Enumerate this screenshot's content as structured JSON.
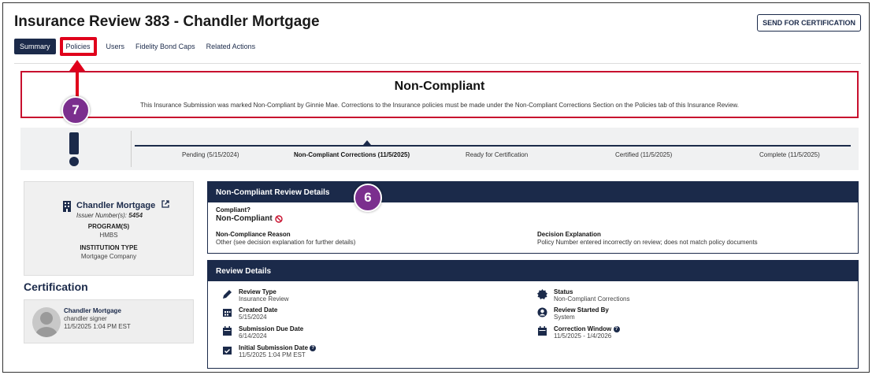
{
  "header": {
    "title": "Insurance Review 383 - Chandler Mortgage",
    "send_button": "SEND FOR CERTIFICATION"
  },
  "tabs": [
    {
      "label": "Summary",
      "active": true
    },
    {
      "label": "Policies",
      "highlighted": true
    },
    {
      "label": "Users"
    },
    {
      "label": "Fidelity Bond Caps"
    },
    {
      "label": "Related Actions"
    }
  ],
  "alert": {
    "title": "Non-Compliant",
    "message": "This Insurance Submission was marked Non-Compliant by Ginnie Mae. Corrections to the Insurance policies must be made under the Non-Compliant Corrections Section on the Policies tab of this Insurance Review."
  },
  "callouts": {
    "seven": "7",
    "six": "6"
  },
  "progress": {
    "steps": [
      {
        "label": "Pending (5/15/2024)"
      },
      {
        "label": "Non-Compliant Corrections (11/5/2025)",
        "current": true
      },
      {
        "label": "Ready for Certification"
      },
      {
        "label": "Certified (11/5/2025)"
      },
      {
        "label": "Complete (11/5/2025)"
      }
    ]
  },
  "issuer": {
    "name": "Chandler Mortgage",
    "number_label": "Issuer Number(s):",
    "number": "5454",
    "program_label": "PROGRAM(S)",
    "program": "HMBS",
    "institution_label": "INSTITUTION TYPE",
    "institution": "Mortgage Company"
  },
  "certification": {
    "heading": "Certification",
    "name": "Chandler Mortgage",
    "user": "chandler signer",
    "datetime": "11/5/2025 1:04 PM EST"
  },
  "nc_details": {
    "header": "Non-Compliant Review Details",
    "compliant_label": "Compliant?",
    "compliant_value": "Non-Compliant",
    "reason_label": "Non-Compliance Reason",
    "reason_value": "Other (see decision explanation for further details)",
    "explanation_label": "Decision Explanation",
    "explanation_value": "Policy Number entered incorrectly on review; does not match policy documents"
  },
  "review_details": {
    "header": "Review Details",
    "review_type_label": "Review Type",
    "review_type": "Insurance Review",
    "created_label": "Created Date",
    "created": "5/15/2024",
    "due_label": "Submission Due Date",
    "due": "6/14/2024",
    "initial_label": "Initial Submission Date",
    "initial": "11/5/2025 1:04 PM EST",
    "status_label": "Status",
    "status": "Non-Compliant Corrections",
    "started_label": "Review Started By",
    "started": "System",
    "window_label": "Correction Window",
    "window": "11/5/2025 - 1/4/2026"
  },
  "colors": {
    "navy": "#1b2a4a",
    "alert_red": "#c8102e",
    "callout_purple": "#7b2f8e",
    "highlight_red": "#e0001b"
  }
}
